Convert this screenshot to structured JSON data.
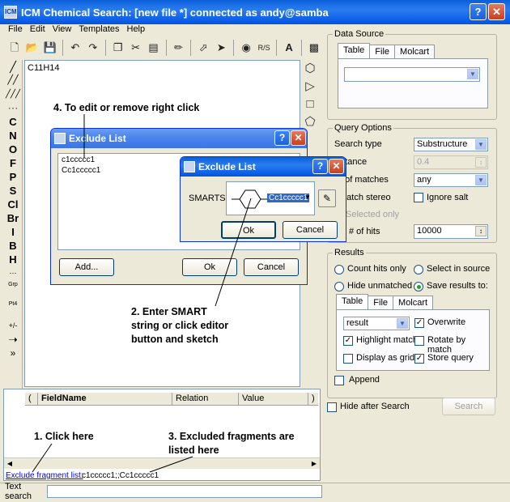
{
  "window": {
    "title": "ICM Chemical Search: [new file *] connected as andy@samba",
    "help_btn": "?",
    "close_btn": "✕"
  },
  "menu": [
    "File",
    "Edit",
    "View",
    "Templates",
    "Help"
  ],
  "toolbar": {
    "rs_label": "R/S"
  },
  "left_tools": [
    "C",
    "N",
    "O",
    "F",
    "P",
    "S",
    "Cl",
    "Br",
    "I",
    "B",
    "H"
  ],
  "left_tools_extra": {
    "grp": "Grp",
    "pt": "Pt4",
    "charge": "+/-"
  },
  "canvas": {
    "formula": "C11H14"
  },
  "data_source": {
    "legend": "Data Source",
    "tabs": [
      "Table",
      "File",
      "Molcart"
    ],
    "table_select": ""
  },
  "query_options": {
    "legend": "Query Options",
    "search_type_label": "Search type",
    "search_type_value": "Substructure",
    "distance_label": "e distance",
    "distance_value": "0.4",
    "matches_label": "nber of matches",
    "matches_value": "any",
    "match_stereo": "Match stereo",
    "ignore_salt": "Ignore salt",
    "selected_only": "Selected only",
    "max_hits_label": "imum # of hits",
    "max_hits_value": "10000"
  },
  "results": {
    "legend": "Results",
    "count_hits": "Count hits only",
    "select_in_source": "Select in source",
    "hide_unmatched": "Hide unmatched",
    "save_results_to": "Save results to:",
    "tabs": [
      "Table",
      "File",
      "Molcart"
    ],
    "result_value": "result",
    "overwrite": "Overwrite",
    "highlight_match": "Highlight match",
    "rotate_by_match": "Rotate by match",
    "display_as_grid": "Display as grid",
    "store_query": "Store query",
    "append": "Append"
  },
  "hide_after_search": "Hide after Search",
  "search_btn": "Search",
  "field_grid": {
    "headers": [
      "(",
      "FieldName",
      "Relation",
      "Value",
      ")"
    ]
  },
  "exclude": {
    "link": "Exclude fragment list:",
    "value": "c1ccccc1;;Cc1ccccc1"
  },
  "statusbar": {
    "label": "Text search"
  },
  "exclude_dialog": {
    "title": "Exclude List",
    "items": [
      "c1ccccc1",
      "Cc1ccccc1"
    ],
    "add_btn": "Add...",
    "ok_btn": "Ok",
    "cancel_btn": "Cancel"
  },
  "smarts_dialog": {
    "title": "Exclude List",
    "label": "SMARTS:",
    "value": "Cc1ccccc1",
    "ok_btn": "Ok",
    "cancel_btn": "Cancel"
  },
  "annotations": {
    "a1": "1. Click here",
    "a2": "2. Enter SMART string or click editor button and sketch",
    "a3": "3. Excluded fragments are listed here",
    "a4": "4. To edit or remove right click"
  }
}
